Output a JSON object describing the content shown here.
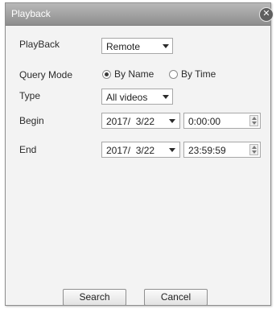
{
  "window": {
    "title": "Playback",
    "close_glyph": "✕"
  },
  "form": {
    "playback": {
      "label": "PlayBack",
      "value": "Remote"
    },
    "query_mode": {
      "label": "Query Mode",
      "options": [
        {
          "label": "By Name",
          "checked": true
        },
        {
          "label": "By Time",
          "checked": false
        }
      ]
    },
    "type": {
      "label": "Type",
      "value": "All videos"
    },
    "begin": {
      "label": "Begin",
      "date": "2017/  3/22",
      "time": "0:00:00"
    },
    "end": {
      "label": "End",
      "date": "2017/  3/22",
      "time": "23:59:59"
    }
  },
  "buttons": {
    "search": "Search",
    "cancel": "Cancel"
  },
  "icons": {
    "close": "close-icon",
    "dropdown": "chevron-down-icon",
    "spinner": "spinner-icon",
    "radio": "radio-icon"
  },
  "colors": {
    "titlebar_top": "#b9b9b9",
    "titlebar_bottom": "#8d8d8d",
    "dialog_bg": "#f3f3f3"
  }
}
